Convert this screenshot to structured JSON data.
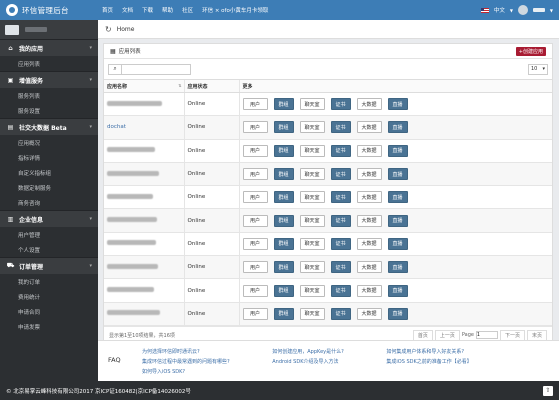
{
  "header": {
    "brand": "环信管理后台",
    "nav": [
      "首页",
      "文档",
      "下载",
      "帮助",
      "社区"
    ],
    "promo": "环信 × ofo小黄车月卡领取",
    "language": "中文"
  },
  "sidebar": {
    "groups": [
      {
        "title": "我的应用",
        "icon": "home-icon",
        "items": [
          "应用列表"
        ]
      },
      {
        "title": "增值服务",
        "icon": "shop-icon",
        "items": [
          "服务列表",
          "服务设置"
        ]
      },
      {
        "title": "社交大数据 Beta",
        "icon": "chart-icon",
        "items": [
          "应用概况",
          "指标详情",
          "自定义指标组",
          "数据定制服务",
          "商务咨询"
        ]
      },
      {
        "title": "企业信息",
        "icon": "building-icon",
        "items": [
          "用户管理",
          "个人设置"
        ]
      },
      {
        "title": "订单管理",
        "icon": "cart-icon",
        "items": [
          "我的订单",
          "费用统计",
          "申请合同",
          "申请发票"
        ]
      }
    ]
  },
  "breadcrumb": {
    "home": "Home"
  },
  "panel": {
    "title": "应用列表",
    "add_button": "+创建应用",
    "search_placeholder": "",
    "page_size": "10",
    "columns": [
      "应用名称",
      "应用状态",
      "更多"
    ],
    "rows": [
      {
        "name": "",
        "status": "Online"
      },
      {
        "name": "dochat",
        "status": "Online"
      },
      {
        "name": "",
        "status": "Online"
      },
      {
        "name": "",
        "status": "Online"
      },
      {
        "name": "",
        "status": "Online"
      },
      {
        "name": "",
        "status": "Online"
      },
      {
        "name": "",
        "status": "Online"
      },
      {
        "name": "",
        "status": "Online"
      },
      {
        "name": "",
        "status": "Online"
      },
      {
        "name": "",
        "status": "Online"
      }
    ],
    "actions": [
      "用户",
      "群组",
      "聊天室",
      "证书",
      "大数据",
      "直播"
    ],
    "summary": "显示第1至10项结果，共16项",
    "pager": {
      "first": "首页",
      "prev": "上一页",
      "page_label": "Page",
      "page_value": "1",
      "next": "下一页",
      "last": "末页"
    }
  },
  "faq": {
    "title": "FAQ",
    "links": [
      "为何选择环信即时通讯云?",
      "如何创建应用，AppKey是什么?",
      "如何集成用户体系和导入好友关系?",
      "",
      "集成环信过程中最常遇到的问题有哪些?",
      "Android SDK介绍及导入方法",
      "集成iOS SDK之前的准备工作【必看】",
      "",
      "如何导入iOS SDK?",
      "",
      "",
      ""
    ]
  },
  "footer": {
    "copyright": "© 北京易掌云峰科技有限公司2017 京ICP证160482|京ICP备14026002号",
    "scroll_top": "⇧"
  }
}
